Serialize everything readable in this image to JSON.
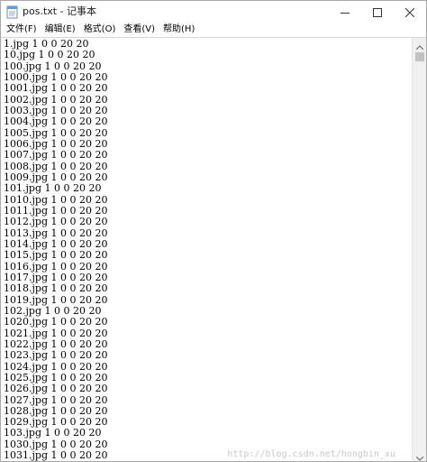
{
  "window": {
    "title": "pos.txt - 记事本"
  },
  "menu": {
    "items": [
      "文件(F)",
      "编辑(E)",
      "格式(O)",
      "查看(V)",
      "帮助(H)"
    ]
  },
  "editor": {
    "lines": [
      "1.jpg 1 0 0 20 20",
      "10.jpg 1 0 0 20 20",
      "100.jpg 1 0 0 20 20",
      "1000.jpg 1 0 0 20 20",
      "1001.jpg 1 0 0 20 20",
      "1002.jpg 1 0 0 20 20",
      "1003.jpg 1 0 0 20 20",
      "1004.jpg 1 0 0 20 20",
      "1005.jpg 1 0 0 20 20",
      "1006.jpg 1 0 0 20 20",
      "1007.jpg 1 0 0 20 20",
      "1008.jpg 1 0 0 20 20",
      "1009.jpg 1 0 0 20 20",
      "101.jpg 1 0 0 20 20",
      "1010.jpg 1 0 0 20 20",
      "1011.jpg 1 0 0 20 20",
      "1012.jpg 1 0 0 20 20",
      "1013.jpg 1 0 0 20 20",
      "1014.jpg 1 0 0 20 20",
      "1015.jpg 1 0 0 20 20",
      "1016.jpg 1 0 0 20 20",
      "1017.jpg 1 0 0 20 20",
      "1018.jpg 1 0 0 20 20",
      "1019.jpg 1 0 0 20 20",
      "102.jpg 1 0 0 20 20",
      "1020.jpg 1 0 0 20 20",
      "1021.jpg 1 0 0 20 20",
      "1022.jpg 1 0 0 20 20",
      "1023.jpg 1 0 0 20 20",
      "1024.jpg 1 0 0 20 20",
      "1025.jpg 1 0 0 20 20",
      "1026.jpg 1 0 0 20 20",
      "1027.jpg 1 0 0 20 20",
      "1028.jpg 1 0 0 20 20",
      "1029.jpg 1 0 0 20 20",
      "103.jpg 1 0 0 20 20",
      "1030.jpg 1 0 0 20 20",
      "1031.jpg 1 0 0 20 20"
    ]
  },
  "watermark": "http://blog.csdn.net/hongbin_xu",
  "icons": {
    "app": "notepad-icon",
    "minimize": "minimize-icon",
    "maximize": "maximize-icon",
    "close": "close-icon",
    "scroll_up": "scroll-up-arrow-icon",
    "scroll_down": "scroll-down-arrow-icon"
  }
}
